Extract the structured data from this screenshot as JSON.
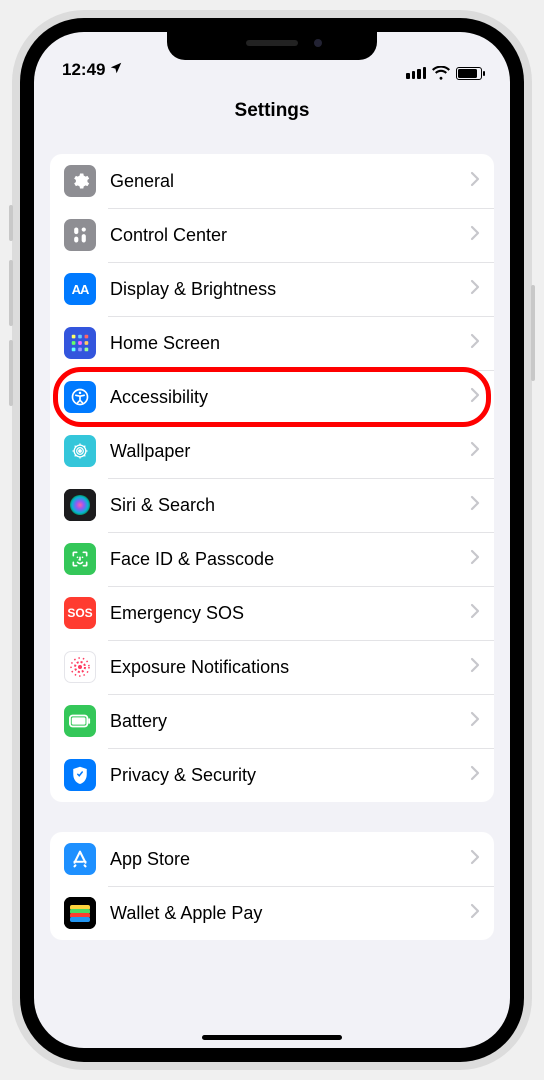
{
  "status": {
    "time": "12:49"
  },
  "title": "Settings",
  "group1": [
    {
      "name": "general",
      "label": "General",
      "bg": "#8e8e93"
    },
    {
      "name": "control-center",
      "label": "Control Center",
      "bg": "#8e8e93"
    },
    {
      "name": "display",
      "label": "Display & Brightness",
      "bg": "#007aff"
    },
    {
      "name": "home-screen",
      "label": "Home Screen",
      "bg": "#3355dd"
    },
    {
      "name": "accessibility",
      "label": "Accessibility",
      "bg": "#007aff",
      "highlight": true
    },
    {
      "name": "wallpaper",
      "label": "Wallpaper",
      "bg": "#34c6da"
    },
    {
      "name": "siri",
      "label": "Siri & Search",
      "bg": "#1c1c1e"
    },
    {
      "name": "face-id",
      "label": "Face ID & Passcode",
      "bg": "#34c759"
    },
    {
      "name": "sos",
      "label": "Emergency SOS",
      "bg": "#ff3b30"
    },
    {
      "name": "exposure",
      "label": "Exposure Notifications",
      "bg": "#ffffff"
    },
    {
      "name": "battery",
      "label": "Battery",
      "bg": "#34c759"
    },
    {
      "name": "privacy",
      "label": "Privacy & Security",
      "bg": "#007aff"
    }
  ],
  "group2": [
    {
      "name": "app-store",
      "label": "App Store",
      "bg": "#1e90ff"
    },
    {
      "name": "wallet",
      "label": "Wallet & Apple Pay",
      "bg": "#000000"
    }
  ]
}
